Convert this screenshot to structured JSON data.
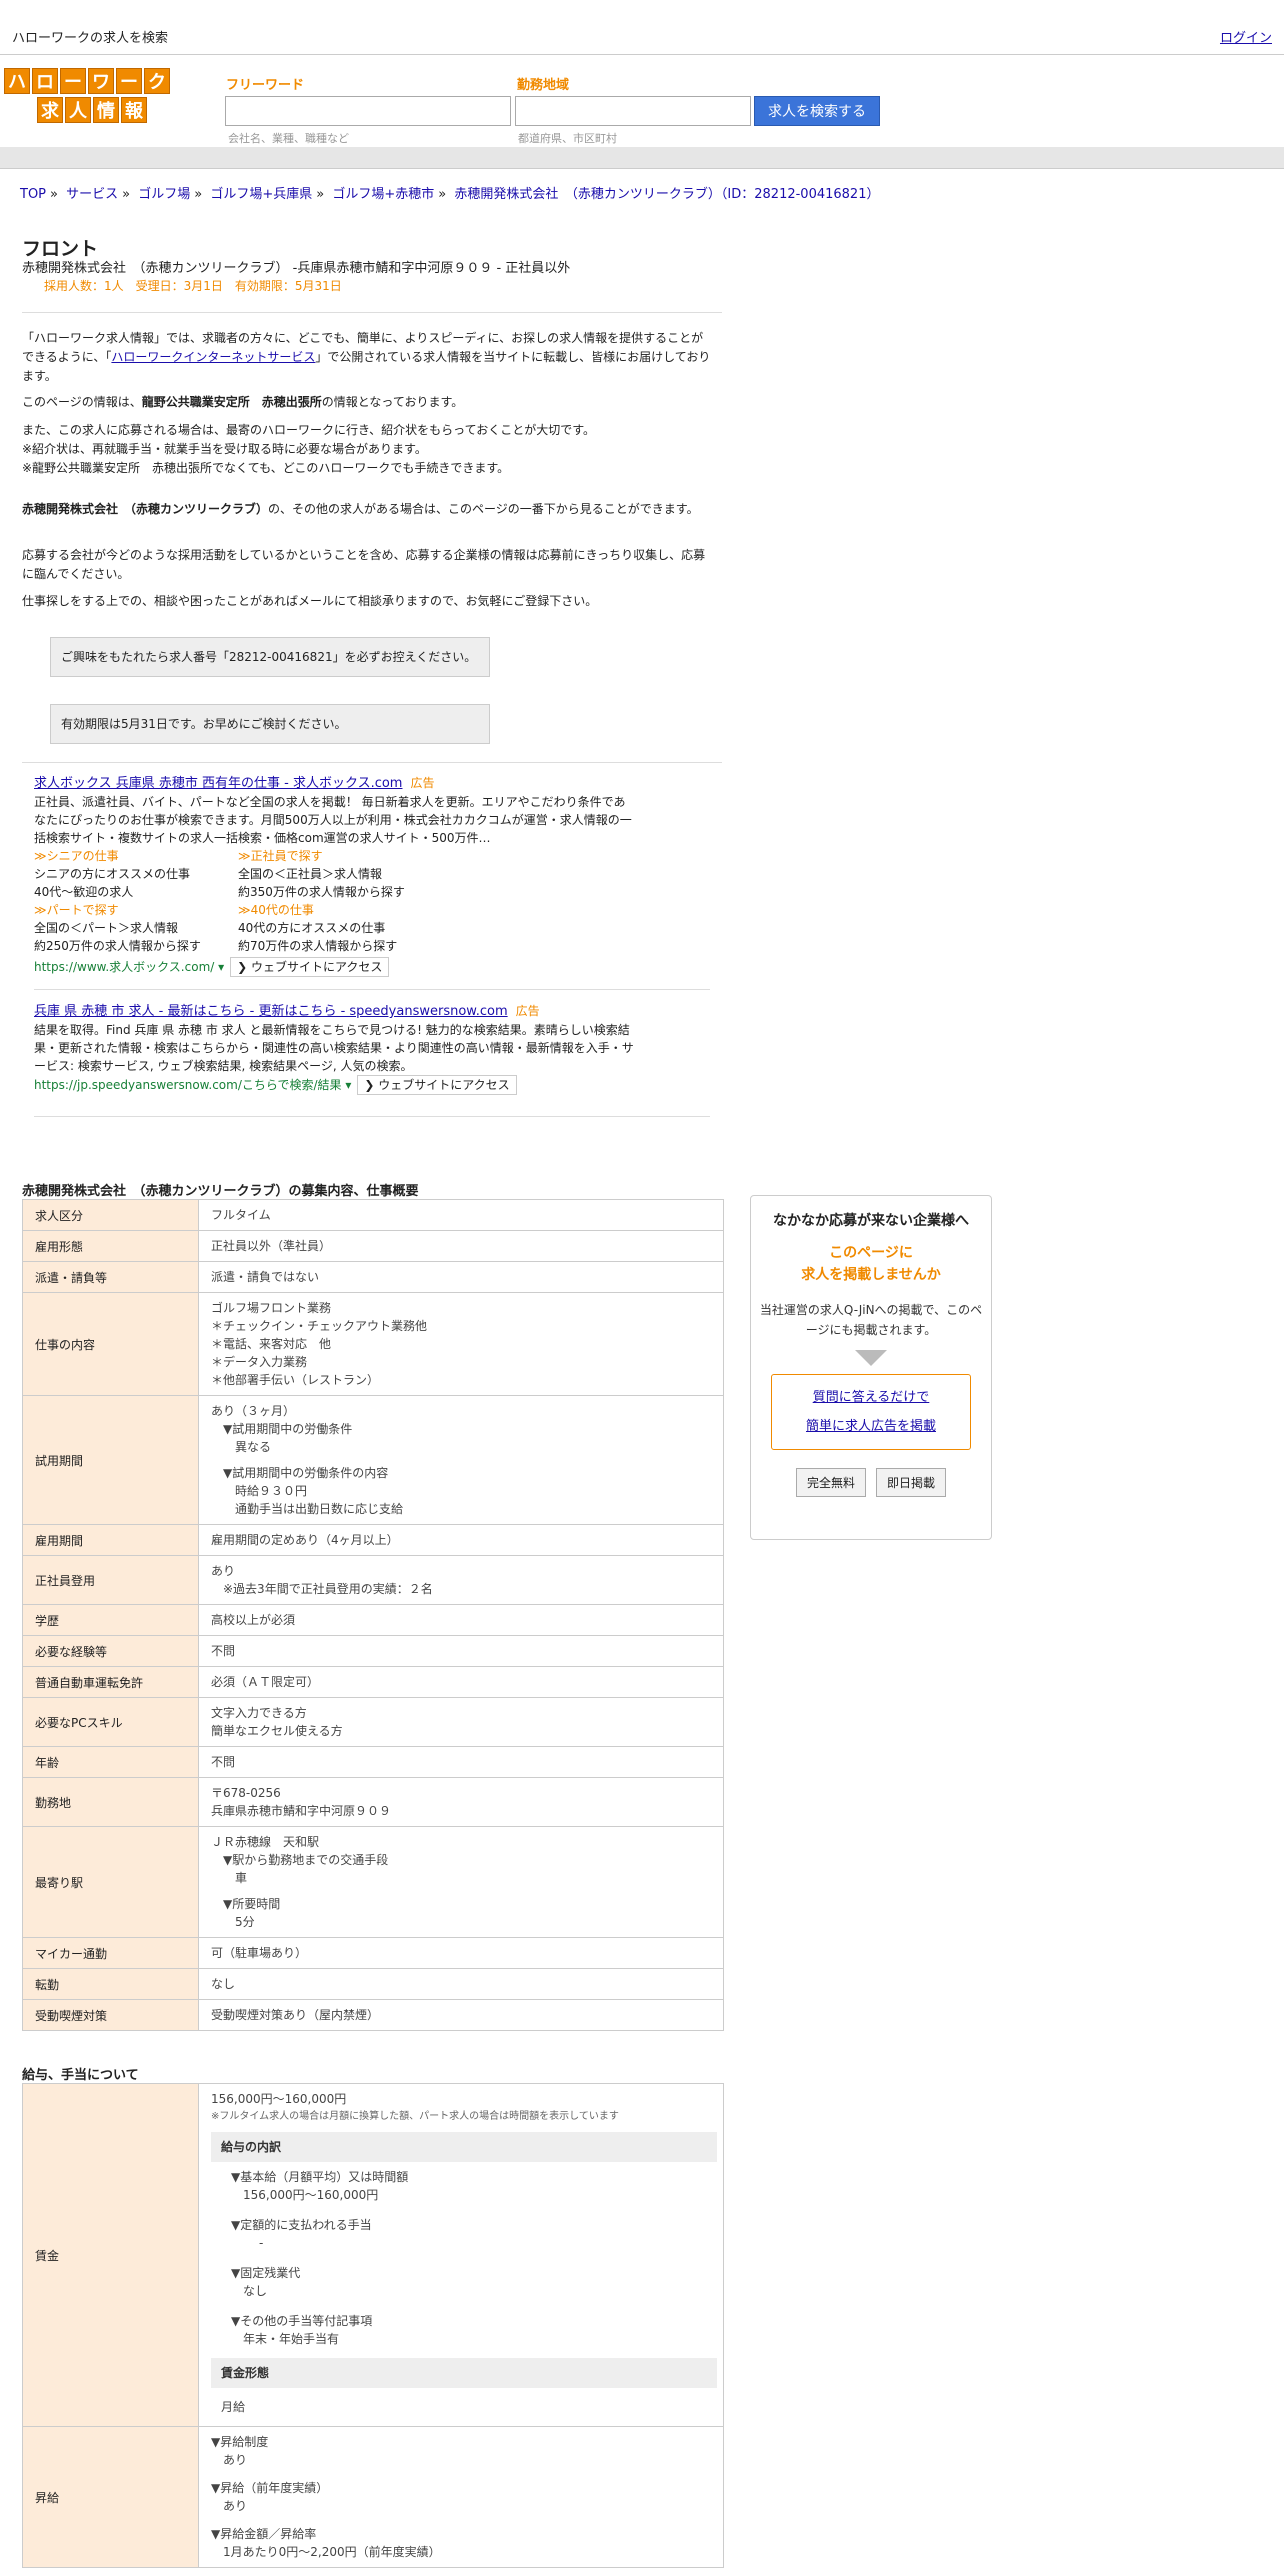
{
  "topbar": {
    "site_name": "ハローワークの求人を検索",
    "login": "ログイン"
  },
  "logo": {
    "row1": [
      "ハ",
      "ロ",
      "ー",
      "ワ",
      "ー",
      "ク"
    ],
    "row2": [
      "求",
      "人",
      "情",
      "報"
    ]
  },
  "search": {
    "keyword_label": "フリーワード",
    "keyword_placeholder": "会社名、業種、職種など",
    "area_label": "勤務地域",
    "area_placeholder": "都道府県、市区町村",
    "button": "求人を検索する"
  },
  "breadcrumb": [
    "TOP",
    "サービス",
    "ゴルフ場",
    "ゴルフ場+兵庫県",
    "ゴルフ場+赤穂市",
    "赤穂開発株式会社　（赤穂カンツリークラブ）（ID：28212-00416821）"
  ],
  "job": {
    "title": "フロント",
    "subtitle": "赤穂開発株式会社　（赤穂カンツリークラブ）  -兵庫県赤穂市鯖和字中河原９０９ - 正社員以外",
    "meta": "採用人数：1人　受理日：3月1日　有効期限：5月31日"
  },
  "intro": {
    "p1_a": "「ハローワーク求人情報」では、求職者の方々に、どこでも、簡単に、よりスピーディに、お探しの求人情報を提供することができるように、「",
    "p1_link": "ハローワークインターネットサービス",
    "p1_b": "」で公開されている求人情報を当サイトに転載し、皆様にお届けしております。",
    "p2_a": "このページの情報は、",
    "p2_bold": "龍野公共職業安定所　赤穂出張所",
    "p2_b": "の情報となっております。",
    "p3": [
      "また、この求人に応募される場合は、最寄のハローワークに行き、紹介状をもらっておくことが大切です。",
      "※紹介状は、再就職手当・就業手当を受け取る時に必要な場合があります。",
      "※龍野公共職業安定所　赤穂出張所でなくても、どこのハローワークでも手続きできます。"
    ],
    "p4_bold": "赤穂開発株式会社　（赤穂カンツリークラブ）",
    "p4_b": "の、その他の求人がある場合は、このページの一番下から見ることができます。",
    "p5": "応募する会社が今どのような採用活動をしているかということを含め、応募する企業様の情報は応募前にきっちり収集し、応募に臨んでください。",
    "p6": "仕事探しをする上での、相談や困ったことがあればメールにて相談承りますので、お気軽にご登録下さい。",
    "box1": "ご興味をもたれたら求人番号「28212-00416821」を必ずお控えください。",
    "box2": "有効期限は5月31日です。お早めにご検討ください。"
  },
  "ads": [
    {
      "headline": "求人ボックス 兵庫県 赤穂市 西有年の仕事 - 求人ボックス.com",
      "tag": "広告",
      "body": "正社員、派遣社員、バイト、パートなど全国の求人を掲載！ 毎日新着求人を更新。エリアやこだわり条件であなたにぴったりのお仕事が検索できます。月間500万人以上が利用・株式会社カカクコムが運営・求人情報の一括検索サイト・複数サイトの求人一括検索・価格com運営の求人サイト・500万件…",
      "sitelinks": [
        {
          "title": "≫シニアの仕事",
          "l1": "シニアの方にオススメの仕事",
          "l2": "40代～歓迎の求人"
        },
        {
          "title": "≫正社員で探す",
          "l1": "全国の＜正社員＞求人情報",
          "l2": "約350万件の求人情報から探す"
        },
        {
          "title": "≫パートで探す",
          "l1": "全国の＜パート＞求人情報",
          "l2": "約250万件の求人情報から探す"
        },
        {
          "title": "≫40代の仕事",
          "l1": "40代の方にオススメの仕事",
          "l2": "約70万件の求人情報から探す"
        }
      ],
      "url": "https://www.求人ボックス.com/ ▾",
      "visit": "❯ ウェブサイトにアクセス"
    },
    {
      "headline": "兵庫 県 赤穂 市 求人 - 最新はこちら - 更新はこちら - speedyanswersnow.com",
      "tag": "広告",
      "body": "結果を取得。Find 兵庫 県 赤穂 市 求人 と最新情報をこちらで見つける! 魅力的な検索結果。素晴らしい検索結果・更新された情報・検索はこちらから・関連性の高い検索結果・より関連性の高い情報・最新情報を入手・サービス: 検索サービス, ウェブ検索結果, 検索結果ページ, 人気の検索。",
      "url": "https://jp.speedyanswersnow.com/こちらで検索/結果 ▾",
      "visit": "❯ ウェブサイトにアクセス"
    }
  ],
  "section1_title": "赤穂開発株式会社　（赤穂カンツリークラブ）の募集内容、仕事概要",
  "details": [
    {
      "k": "求人区分",
      "v": [
        "フルタイム"
      ]
    },
    {
      "k": "雇用形態",
      "v": [
        "正社員以外（準社員）"
      ]
    },
    {
      "k": "派遣・請負等",
      "v": [
        "派遣・請負ではない"
      ]
    },
    {
      "k": "仕事の内容",
      "v": [
        "ゴルフ場フロント業務",
        "＊チェックイン・チェックアウト業務他",
        "＊電話、来客対応　他",
        "＊データ入力業務",
        "＊他部署手伝い（レストラン）"
      ]
    },
    {
      "k": "試用期間",
      "v": [
        "あり（３ヶ月）",
        "　▼試用期間中の労働条件",
        "　　異なる",
        "",
        "　▼試用期間中の労働条件の内容",
        "　　時給９３０円",
        "　　通勤手当は出勤日数に応じ支給"
      ]
    },
    {
      "k": "雇用期間",
      "v": [
        "雇用期間の定めあり（4ヶ月以上）"
      ]
    },
    {
      "k": "正社員登用",
      "v": [
        "あり",
        "　※過去3年間で正社員登用の実績：２名"
      ]
    },
    {
      "k": "学歴",
      "v": [
        "高校以上が必須"
      ]
    },
    {
      "k": "必要な経験等",
      "v": [
        "不問"
      ]
    },
    {
      "k": "普通自動車運転免許",
      "v": [
        "必須（ＡＴ限定可）"
      ]
    },
    {
      "k": "必要なPCスキル",
      "v": [
        "文字入力できる方",
        "簡単なエクセル使える方"
      ]
    },
    {
      "k": "年齢",
      "v": [
        "不問"
      ]
    },
    {
      "k": "勤務地",
      "v": [
        "〒678-0256",
        "兵庫県赤穂市鯖和字中河原９０９"
      ]
    },
    {
      "k": "最寄り駅",
      "v": [
        "ＪＲ赤穂線　天和駅",
        "　▼駅から勤務地までの交通手段",
        "　　車",
        "",
        "　▼所要時間",
        "　　5分"
      ]
    },
    {
      "k": "マイカー通勤",
      "v": [
        "可（駐車場あり）"
      ]
    },
    {
      "k": "転勤",
      "v": [
        "なし"
      ]
    },
    {
      "k": "受動喫煙対策",
      "v": [
        "受動喫煙対策あり（屋内禁煙）"
      ]
    }
  ],
  "section2_title": "給与、手当について",
  "salary": {
    "label": "賃金",
    "range": "156,000円〜160,000円",
    "note": "※フルタイム求人の場合は月額に換算した額、パート求人の場合は時間額を表示しています",
    "breakdown_title": "給与の内訳",
    "items": [
      {
        "t": "▼基本給（月額平均）又は時間額",
        "v": "156,000円〜160,000円"
      },
      {
        "t": "▼定額的に支払われる手当",
        "v": "-"
      },
      {
        "t": "▼固定残業代",
        "v": "なし"
      },
      {
        "t": "▼その他の手当等付記事項",
        "v": "年末・年始手当有"
      }
    ],
    "form_title": "賃金形態",
    "form_value": "月給"
  },
  "raise": {
    "label": "昇給",
    "items": [
      {
        "t": "▼昇給制度",
        "v": "あり"
      },
      {
        "t": "▼昇給（前年度実績）",
        "v": "あり"
      },
      {
        "t": "▼昇給金額／昇給率",
        "v": "1月あたり0円〜2,200円（前年度実績）"
      }
    ]
  },
  "promo": {
    "title": "なかなか応募が来ない企業様へ",
    "catch1": "このページに",
    "catch2": "求人を掲載しませんか",
    "desc": "当社運営の求人Q-JiNへの掲載で、このページにも掲載されます。",
    "link1": "質問に答えるだけで",
    "link2": "簡単に求人広告を掲載",
    "btn1": "完全無料",
    "btn2": "即日掲載"
  }
}
